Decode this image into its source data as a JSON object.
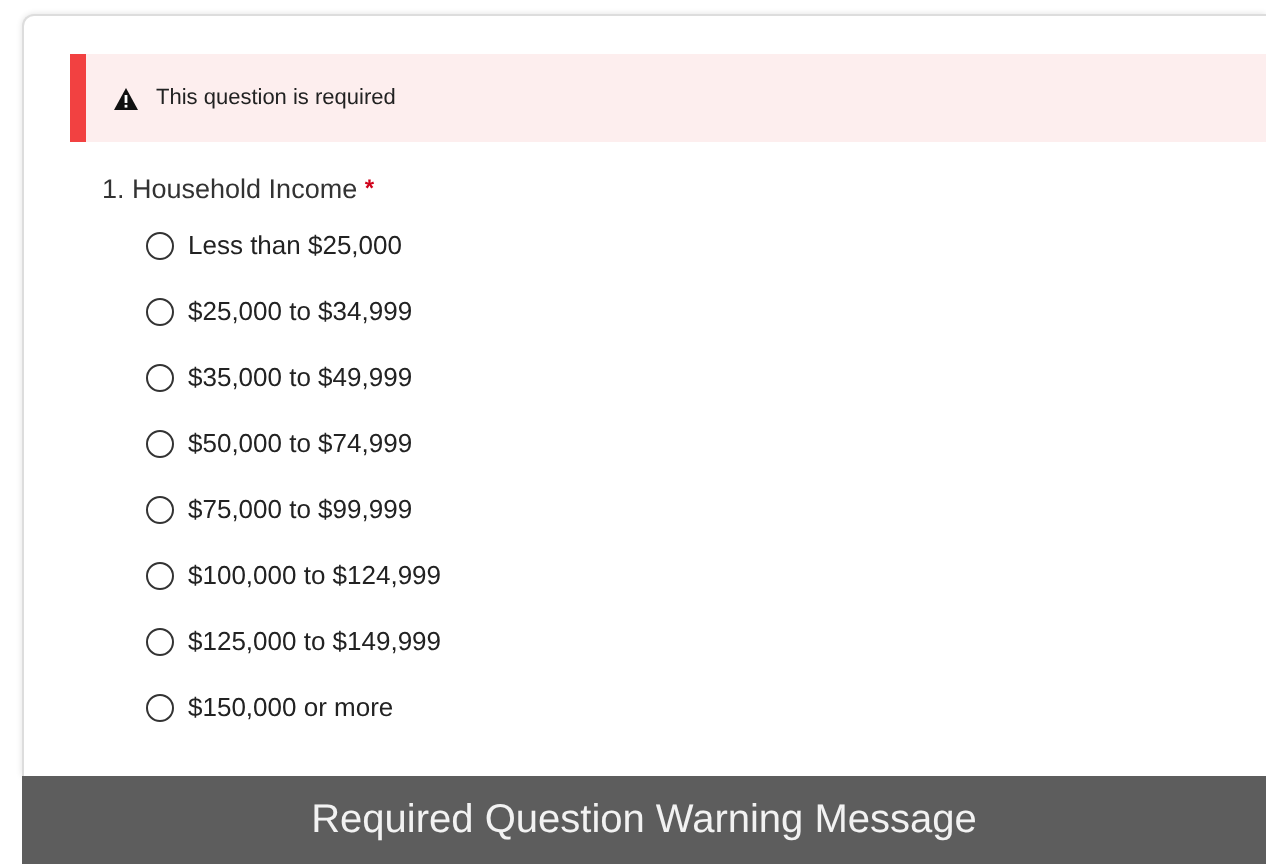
{
  "alert": {
    "text": "This question is required"
  },
  "question": {
    "number": "1.",
    "title": "Household Income",
    "required_mark": "*",
    "required": true
  },
  "options": [
    {
      "label": "Less than $25,000",
      "selected": false
    },
    {
      "label": "$25,000 to $34,999",
      "selected": false
    },
    {
      "label": "$35,000 to $49,999",
      "selected": false
    },
    {
      "label": "$50,000 to $74,999",
      "selected": false
    },
    {
      "label": "$75,000 to $99,999",
      "selected": false
    },
    {
      "label": "$100,000 to $124,999",
      "selected": false
    },
    {
      "label": "$125,000 to $149,999",
      "selected": false
    },
    {
      "label": "$150,000 or more",
      "selected": false
    }
  ],
  "caption": "Required Question Warning Message"
}
